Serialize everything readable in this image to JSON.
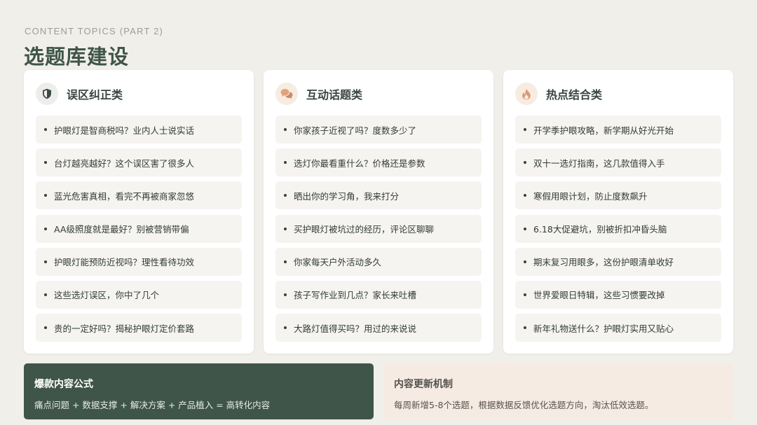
{
  "header": {
    "subtitle": "CONTENT TOPICS (PART 2)",
    "title": "选题库建设"
  },
  "columns": [
    {
      "title": "误区纠正类",
      "icon": "shield-icon",
      "items": [
        "护眼灯是智商税吗？业内人士说实话",
        "台灯越亮越好？这个误区害了很多人",
        "蓝光危害真相，看完不再被商家忽悠",
        "AA级照度就是最好？别被营销带偏",
        "护眼灯能预防近视吗？理性看待功效",
        "这些选灯误区，你中了几个",
        "贵的一定好吗？揭秘护眼灯定价套路"
      ]
    },
    {
      "title": "互动话题类",
      "icon": "chat-bubbles-icon",
      "items": [
        "你家孩子近视了吗？度数多少了",
        "选灯你最看重什么？价格还是参数",
        "晒出你的学习角，我来打分",
        "买护眼灯被坑过的经历，评论区聊聊",
        "你家每天户外活动多久",
        "孩子写作业到几点？家长来吐槽",
        "大路灯值得买吗？用过的来说说"
      ]
    },
    {
      "title": "热点结合类",
      "icon": "flame-icon",
      "items": [
        "开学季护眼攻略，新学期从好光开始",
        "双十一选灯指南，这几款值得入手",
        "寒假用眼计划，防止度数飙升",
        "6.18大促避坑，别被折扣冲昏头脑",
        "期末复习用眼多，这份护眼清单收好",
        "世界爱眼日特辑，这些习惯要改掉",
        "新年礼物送什么？护眼灯实用又贴心"
      ]
    }
  ],
  "formula": {
    "title": "爆款内容公式",
    "text": "痛点问题 + 数据支撑 + 解决方案 + 产品植入 = 高转化内容"
  },
  "update": {
    "title": "内容更新机制",
    "text": "每周新增5-8个选题，根据数据反馈优化选题方向，淘汰低效选题。"
  },
  "colors": {
    "background": "#f1efea",
    "accent_green": "#3f5549",
    "peach": "#f6ebe3",
    "item_bg": "#f5f4f1"
  }
}
